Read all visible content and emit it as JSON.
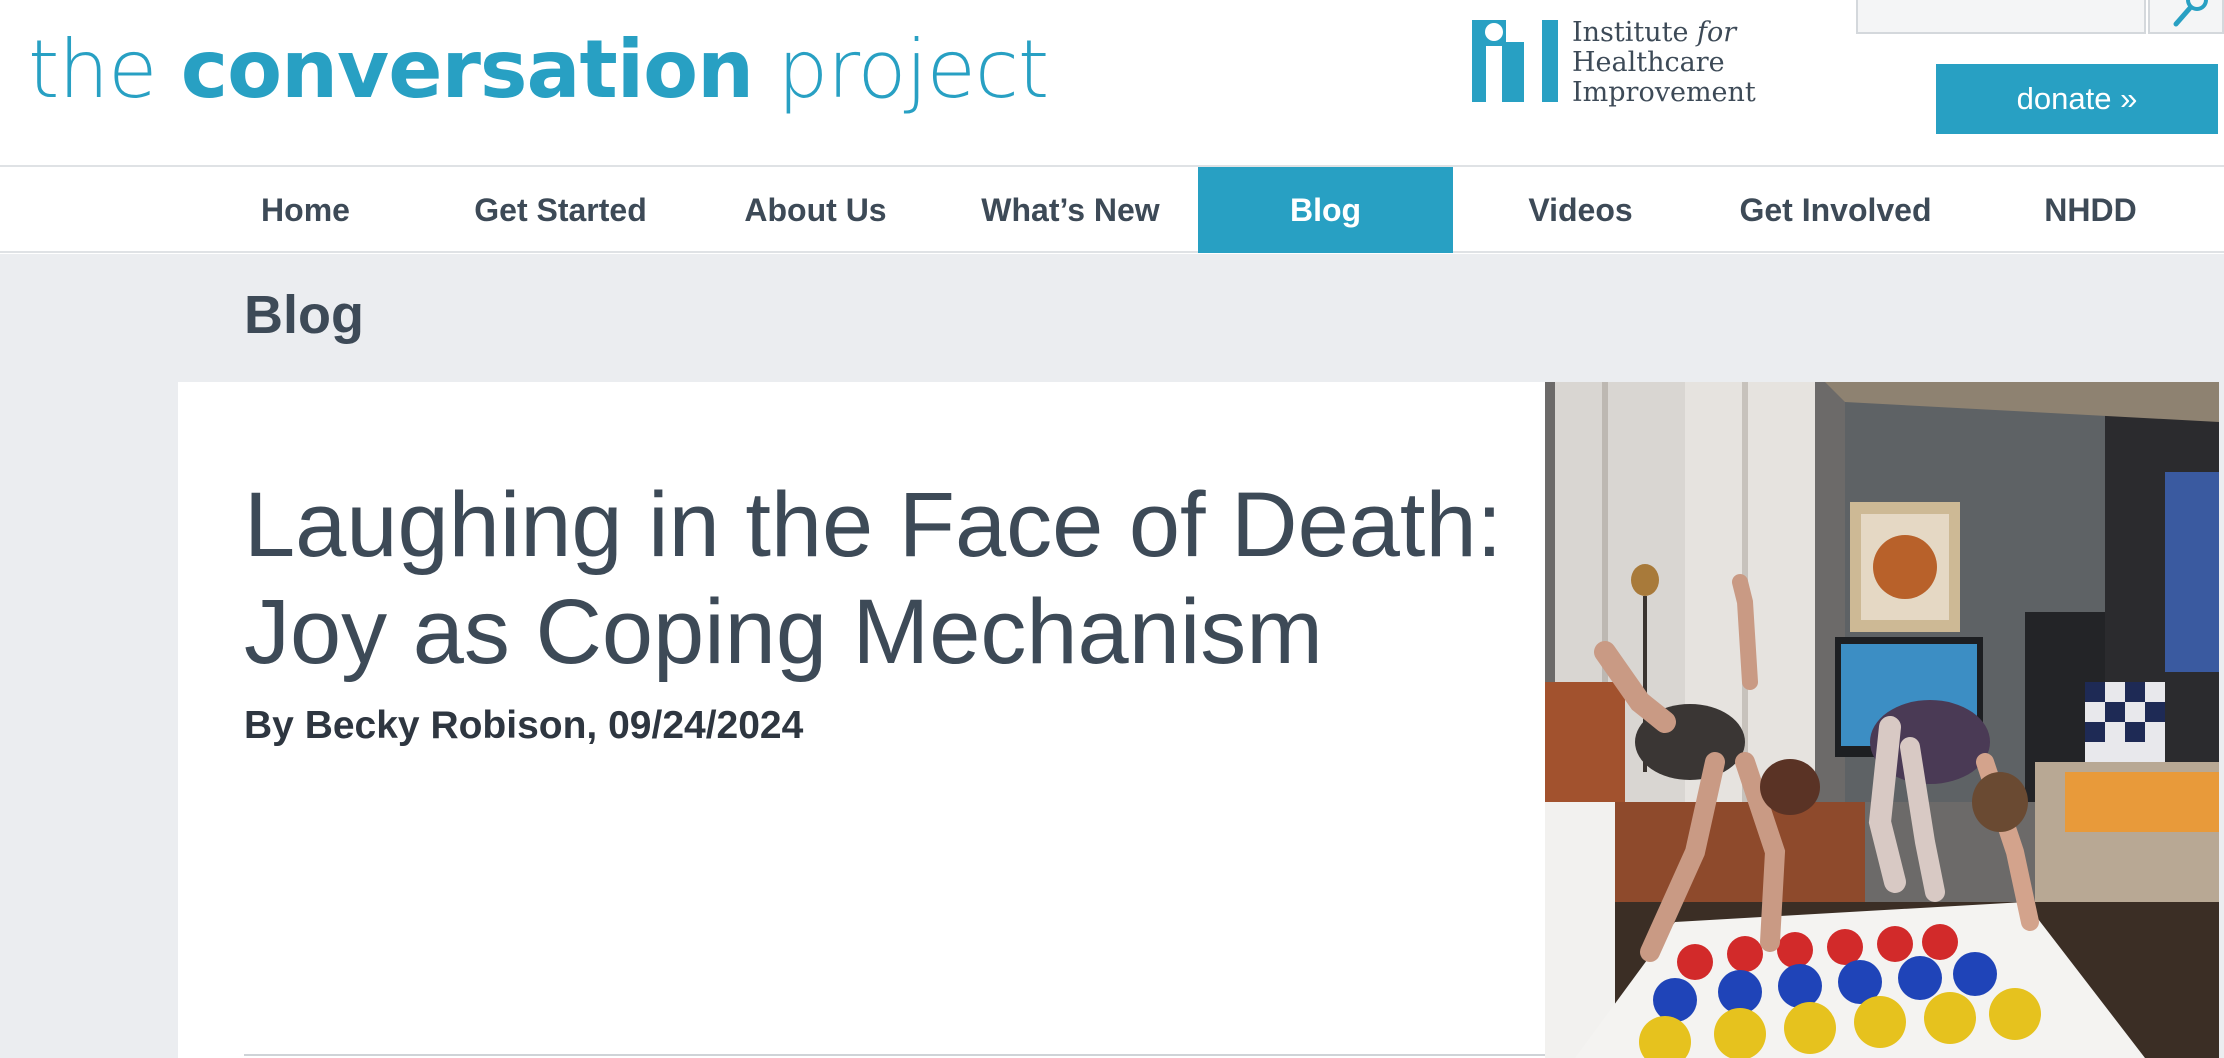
{
  "header": {
    "logo": {
      "part1": "the ",
      "part2": "conversation",
      "part3": " project"
    },
    "partner": {
      "line1": "Institute ",
      "line1_italic": "for",
      "line2": "Healthcare",
      "line3": "Improvement"
    },
    "search": {
      "placeholder": ""
    },
    "donate_label": "donate »"
  },
  "nav": {
    "items": [
      {
        "label": "Home"
      },
      {
        "label": "Get Started"
      },
      {
        "label": "About Us"
      },
      {
        "label": "What’s New"
      },
      {
        "label": "Blog",
        "active": true
      },
      {
        "label": "Videos"
      },
      {
        "label": "Get Involved"
      },
      {
        "label": "NHDD"
      }
    ]
  },
  "page": {
    "section_title": "Blog",
    "post": {
      "title_line1": "Laughing in the Face of Death:",
      "title_line2": "Joy as Coping Mechanism",
      "byline": "By Becky Robison, 09/24/2024"
    }
  },
  "colors": {
    "brand": "#28a0c3",
    "text": "#3d4a57",
    "background": "#ebedf0"
  }
}
